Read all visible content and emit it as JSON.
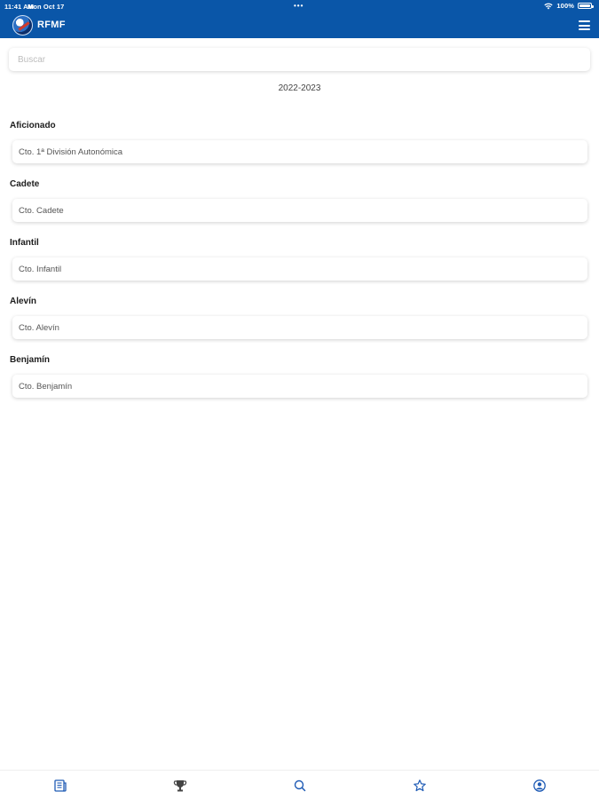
{
  "status_bar": {
    "time": "11:41 AM",
    "date": "Mon Oct 17",
    "dots": "•••",
    "battery": "100%"
  },
  "header": {
    "brand": "RFMF",
    "logo_icon": "rfmf-logo",
    "menu_icon": "hamburger-menu-icon",
    "background": "#0a56a8"
  },
  "search": {
    "placeholder": "Buscar",
    "value": ""
  },
  "season": "2022-2023",
  "categories": [
    {
      "label": "Aficionado",
      "competition": "Cto. 1ª División Autonómica"
    },
    {
      "label": "Cadete",
      "competition": "Cto. Cadete"
    },
    {
      "label": "Infantil",
      "competition": "Cto. Infantil"
    },
    {
      "label": "Alevín",
      "competition": "Cto. Alevín"
    },
    {
      "label": "Benjamín",
      "competition": "Cto. Benjamín"
    }
  ],
  "tab_bar": {
    "items": [
      {
        "icon": "news-icon"
      },
      {
        "icon": "trophy-icon"
      },
      {
        "icon": "search-icon"
      },
      {
        "icon": "star-icon"
      },
      {
        "icon": "profile-icon"
      }
    ],
    "accent": "#1f5bb5"
  }
}
